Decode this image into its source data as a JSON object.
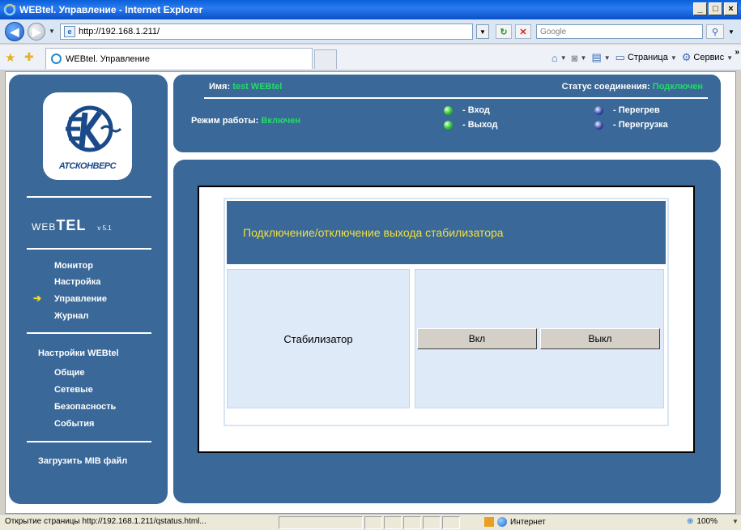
{
  "window": {
    "title": "WEBtel. Управление - Internet Explorer",
    "controls": {
      "minimize": "_",
      "maximize": "□",
      "close": "×"
    }
  },
  "browser": {
    "address": "http://192.168.1.211/",
    "search_placeholder": "Google",
    "tab_title": "WEBtel. Управление",
    "commands": {
      "page": "Страница",
      "service": "Сервис"
    },
    "icons": [
      "back-icon",
      "forward-icon",
      "page-icon",
      "refresh-icon",
      "stop-icon",
      "search-icon",
      "favorites-star-icon",
      "add-favorites-icon",
      "home-icon",
      "feeds-icon",
      "print-icon",
      "page-menu-icon",
      "tools-gear-icon"
    ]
  },
  "sidebar": {
    "logo_text": "АТСКОНВЕРС",
    "product": {
      "pre": "WEB",
      "bold": "TEL",
      "version": "v 5.1"
    },
    "menu": [
      {
        "label": "Монитор",
        "active": false
      },
      {
        "label": "Настройка",
        "active": false
      },
      {
        "label": "Управление",
        "active": true
      },
      {
        "label": "Журнал",
        "active": false
      }
    ],
    "settings_heading": "Настройки WEBtel",
    "settings": [
      {
        "label": "Общие"
      },
      {
        "label": "Сетевые"
      },
      {
        "label": "Безопасность"
      },
      {
        "label": "События"
      }
    ],
    "upload_mib": "Загрузить MIB файл"
  },
  "header": {
    "name_label": "Имя:",
    "name_value": "test WEBtel",
    "status_label": "Статус соединения:",
    "status_value": "Подключен",
    "mode_label": "Режим работы:",
    "mode_value": "Включен",
    "legend": {
      "input": "- Вход",
      "output": "- Выход",
      "overheat": "- Перегрев",
      "overload": "- Перегрузка"
    }
  },
  "main": {
    "title": "Подключение/отключение выхода стабилизатора",
    "device_label": "Стабилизатор",
    "btn_on": "Вкл",
    "btn_off": "Выкл"
  },
  "statusbar": {
    "text": "Открытие страницы http://192.168.1.211/qstatus.html...",
    "zone": "Интернет",
    "zoom": "100%"
  },
  "colors": {
    "panel": "#3a6898",
    "accent_green": "#22dd66",
    "title_yellow": "#f0e040",
    "cell_bg": "#dfeaf8"
  }
}
